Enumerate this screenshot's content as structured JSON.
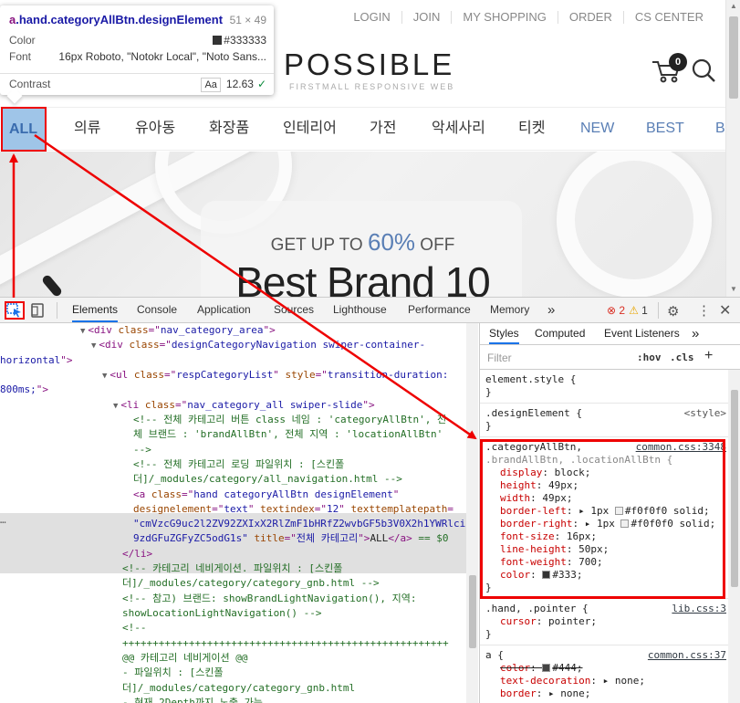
{
  "tooltip": {
    "title_tag": "a",
    "title_rest": ".hand.categoryAllBtn.designElement",
    "dims": "51 × 49",
    "color_label": "Color",
    "color_value": "#333333",
    "font_label": "Font",
    "font_value": "16px Roboto, \"Notokr Local\", \"Noto Sans...",
    "contrast_label": "Contrast",
    "contrast_aa": "Aa",
    "contrast_value": "12.63",
    "check": "✓"
  },
  "site": {
    "topnav": [
      "LOGIN",
      "JOIN",
      "MY SHOPPING",
      "ORDER",
      "CS CENTER"
    ],
    "logo_main": "POSSIBLE",
    "logo_sub": "FIRSTMALL RESPONSIVE WEB",
    "cart_count": "0",
    "categories": [
      "ALL",
      "의류",
      "유아동",
      "화장품",
      "인테리어",
      "가전",
      "악세사리",
      "티켓",
      "NEW",
      "BEST",
      "B"
    ],
    "promo_prefix": "GET UP TO ",
    "promo_percent": "60%",
    "promo_suffix": " OFF",
    "promo_headline": "Best Brand 10"
  },
  "devtools": {
    "tabs": [
      "Elements",
      "Console",
      "Application",
      "Sources",
      "Lighthouse",
      "Performance",
      "Memory"
    ],
    "more_tabs": "»",
    "errors": "2",
    "warnings": "1",
    "styles_tabs": [
      "Styles",
      "Computed",
      "Event Listeners"
    ],
    "filter_placeholder": "Filter",
    "hov": ":hov",
    "cls": ".cls",
    "plus": "+",
    "dom_lines": [
      {
        "indent": 88,
        "arrow": "▼",
        "parts": [
          [
            "tg",
            "<div "
          ],
          [
            "at",
            "class"
          ],
          [
            "tg",
            "=\""
          ],
          [
            "av",
            "nav_category_area"
          ],
          [
            "tg",
            "\">"
          ]
        ]
      },
      {
        "indent": 100,
        "arrow": "▼",
        "parts": [
          [
            "tg",
            "<div "
          ],
          [
            "at",
            "class"
          ],
          [
            "tg",
            "=\""
          ],
          [
            "av",
            "designCategoryNavigation swiper-container-"
          ]
        ]
      },
      {
        "indent": 0,
        "arrow": "",
        "parts": [
          [
            "av",
            "horizontal"
          ],
          [
            "tg",
            "\">"
          ]
        ]
      },
      {
        "indent": 112,
        "arrow": "▼",
        "parts": [
          [
            "tg",
            "<ul "
          ],
          [
            "at",
            "class"
          ],
          [
            "tg",
            "=\""
          ],
          [
            "av",
            "respCategoryList"
          ],
          [
            "tg",
            "\" "
          ],
          [
            "at",
            "style"
          ],
          [
            "tg",
            "=\""
          ],
          [
            "av",
            "transition-duration:"
          ]
        ]
      },
      {
        "indent": 0,
        "arrow": "",
        "parts": [
          [
            "av",
            "800ms;"
          ],
          [
            "tg",
            "\">"
          ]
        ]
      },
      {
        "indent": 124,
        "arrow": "▼",
        "parts": [
          [
            "tg",
            "<li "
          ],
          [
            "at",
            "class"
          ],
          [
            "tg",
            "=\""
          ],
          [
            "av",
            "nav_category_all swiper-slide"
          ],
          [
            "tg",
            "\">"
          ]
        ]
      },
      {
        "indent": 146,
        "arrow": "",
        "parts": [
          [
            "cm",
            "<!-- 전체 카테고리 버튼 class 네임 : 'categoryAllBtn', 전"
          ]
        ]
      },
      {
        "indent": 146,
        "arrow": "",
        "parts": [
          [
            "cm",
            "체 브랜드 : 'brandAllBtn', 전체 지역 : 'locationAllBtn'"
          ]
        ]
      },
      {
        "indent": 146,
        "arrow": "",
        "parts": [
          [
            "cm",
            "-->"
          ]
        ]
      },
      {
        "indent": 146,
        "arrow": "",
        "parts": [
          [
            "cm",
            "<!-- 전체 카테고리 로딩 파일위치 : [스킨폴"
          ]
        ]
      },
      {
        "indent": 146,
        "arrow": "",
        "parts": [
          [
            "cm",
            "더]/_modules/category/all_navigation.html -->"
          ]
        ]
      },
      {
        "indent": 146,
        "arrow": "",
        "parts": [
          [
            "tg",
            "<a "
          ],
          [
            "at",
            "class"
          ],
          [
            "tg",
            "=\""
          ],
          [
            "av",
            "hand categoryAllBtn designElement"
          ],
          [
            "tg",
            "\""
          ]
        ]
      },
      {
        "indent": 146,
        "arrow": "",
        "parts": [
          [
            "at",
            "designelement"
          ],
          [
            "tg",
            "=\""
          ],
          [
            "av",
            "text"
          ],
          [
            "tg",
            "\" "
          ],
          [
            "at",
            "textindex"
          ],
          [
            "tg",
            "=\""
          ],
          [
            "av",
            "12"
          ],
          [
            "tg",
            "\" "
          ],
          [
            "at",
            "texttemplatepath"
          ],
          [
            "tg",
            "="
          ]
        ]
      },
      {
        "indent": 146,
        "arrow": "",
        "parts": [
          [
            "av",
            "\"cmVzcG9uc2l2ZV92ZXIxX2RlZmF1bHRfZ2wvbGF5b3V0X2h1YWRlci"
          ]
        ]
      },
      {
        "indent": 146,
        "arrow": "",
        "parts": [
          [
            "av",
            "9zdGFuZGFyZC5odG1s\""
          ],
          [
            "tg",
            " "
          ],
          [
            "at",
            "title"
          ],
          [
            "tg",
            "=\""
          ],
          [
            "av",
            "전체 카테고리"
          ],
          [
            "tg",
            "\">"
          ],
          [
            "txt",
            "ALL"
          ],
          [
            "tg",
            "</a>"
          ],
          [
            "cm",
            " == $0"
          ]
        ]
      },
      {
        "indent": 134,
        "arrow": "",
        "parts": [
          [
            "tg",
            "</li>"
          ]
        ]
      },
      {
        "indent": 134,
        "arrow": "",
        "parts": [
          [
            "cm",
            "<!-- 카테고리 네비게이션. 파일위치 : [스킨폴"
          ]
        ]
      },
      {
        "indent": 134,
        "arrow": "",
        "parts": [
          [
            "cm",
            "더]/_modules/category/category_gnb.html -->"
          ]
        ]
      },
      {
        "indent": 134,
        "arrow": "",
        "parts": [
          [
            "cm",
            "<!-- 참고) 브랜드: showBrandLightNavigation(), 지역:"
          ]
        ]
      },
      {
        "indent": 134,
        "arrow": "",
        "parts": [
          [
            "cm",
            "showLocationLightNavigation() -->"
          ]
        ]
      },
      {
        "indent": 134,
        "arrow": "",
        "parts": [
          [
            "cm",
            "<!--"
          ]
        ]
      },
      {
        "indent": 134,
        "arrow": "",
        "parts": [
          [
            "cm",
            "++++++++++++++++++++++++++++++++++++++++++++++++++++++"
          ]
        ]
      },
      {
        "indent": 134,
        "arrow": "",
        "parts": [
          [
            "cm",
            "@@ 카테고리 네비게이션 @@"
          ]
        ]
      },
      {
        "indent": 134,
        "arrow": "",
        "parts": [
          [
            "cm",
            "- 파일위치 : [스킨폴"
          ]
        ]
      },
      {
        "indent": 134,
        "arrow": "",
        "parts": [
          [
            "cm",
            "더]/_modules/category/category_gnb.html"
          ]
        ]
      },
      {
        "indent": 134,
        "arrow": "",
        "parts": [
          [
            "cm",
            "- 현재 2Depth까지 노출 가능"
          ]
        ]
      }
    ],
    "ellipsis": "…",
    "style_rules": [
      {
        "selector": "element.style {",
        "selector2": "",
        "source": "",
        "plain": true,
        "props": [],
        "close": "}"
      },
      {
        "selector": ".designElement {",
        "selector2": "",
        "source": "<style>",
        "plain": true,
        "props": [],
        "close": "}"
      },
      {
        "selector": ".categoryAllBtn,",
        "selector2": ".brandAllBtn, .locationAllBtn {",
        "source": "common.css:3348",
        "plain": false,
        "props": [
          {
            "n": "display",
            "v": "block;",
            "strike": false
          },
          {
            "n": "height",
            "v": "49px;",
            "strike": false
          },
          {
            "n": "width",
            "v": "49px;",
            "strike": false
          },
          {
            "n": "border-left",
            "v": "▸ 1px ",
            "sw": "#f0f0f0",
            "v2": "#f0f0f0 solid;",
            "strike": false
          },
          {
            "n": "border-right",
            "v": "▸ 1px ",
            "sw": "#f0f0f0",
            "v2": "#f0f0f0 solid;",
            "strike": false
          },
          {
            "n": "font-size",
            "v": "16px;",
            "strike": false
          },
          {
            "n": "line-height",
            "v": "50px;",
            "strike": false
          },
          {
            "n": "font-weight",
            "v": "700;",
            "strike": false
          },
          {
            "n": "color",
            "v": "",
            "sw": "#333333",
            "v2": "#333;",
            "strike": false
          }
        ],
        "close": "}"
      },
      {
        "selector": ".hand, .pointer {",
        "selector2": "",
        "source": "lib.css:3",
        "plain": false,
        "props": [
          {
            "n": "cursor",
            "v": "pointer;",
            "strike": false
          }
        ],
        "close": "}"
      },
      {
        "selector": "a {",
        "selector2": "",
        "source": "common.css:37",
        "plain": false,
        "props": [
          {
            "n": "color",
            "v": "",
            "sw": "#444444",
            "v2": "#444;",
            "strike": true
          },
          {
            "n": "text-decoration",
            "v": "▸ none;",
            "strike": false
          },
          {
            "n": "border",
            "v": "▸ none;",
            "strike": false
          }
        ],
        "close": ""
      }
    ]
  },
  "colors": {
    "annotation_red": "#ee0000",
    "accent_blue": "#1a73e8",
    "all_button_bg": "#9fc5e8"
  }
}
